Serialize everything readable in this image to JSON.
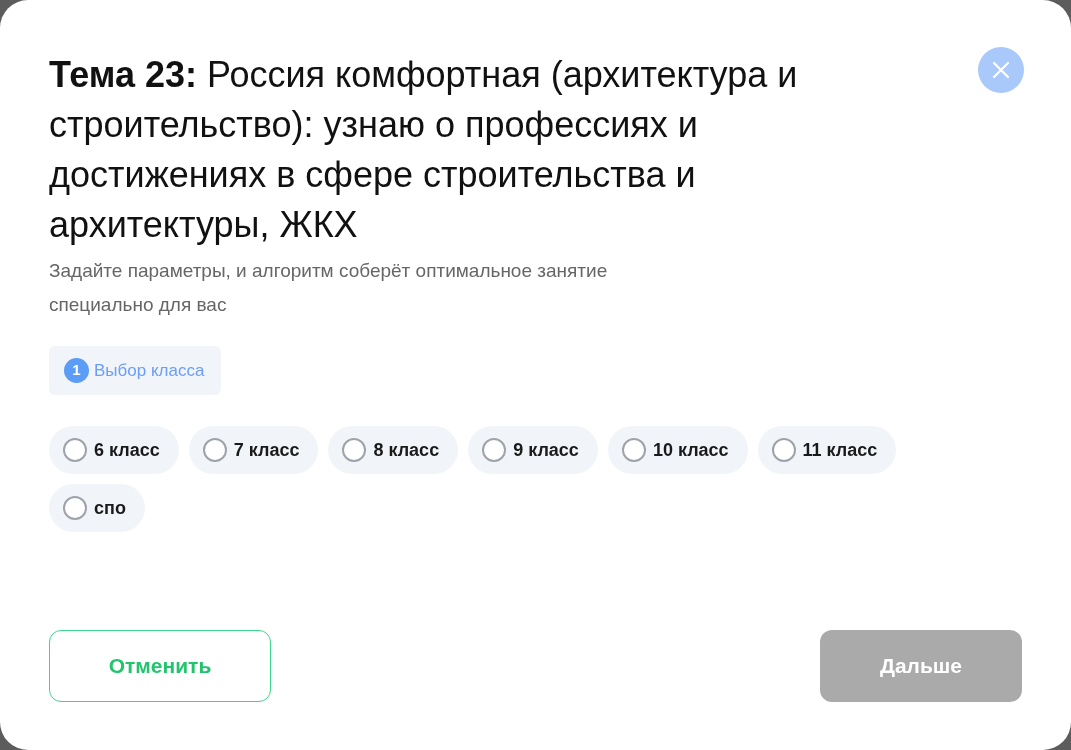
{
  "dialog": {
    "title": "**Тема 23:** Россия комфортная (архитектура и строительство): узнаю о профессиях и достижениях в сфере строительства и архитектуры, ЖКХ",
    "subtitle": "Задайте параметры, и алгоритм соберёт оптимальное занятие специально для вас",
    "steps": [
      {
        "number": "1",
        "label": "Выбор класса",
        "active": true
      }
    ],
    "options": [
      {
        "label": "6 класс",
        "selected": false
      },
      {
        "label": "7 класс",
        "selected": false
      },
      {
        "label": "8 класс",
        "selected": false
      },
      {
        "label": "9 класс",
        "selected": false
      },
      {
        "label": "10 класс",
        "selected": false
      },
      {
        "label": "11 класс",
        "selected": false
      },
      {
        "label": "спо",
        "selected": false
      }
    ],
    "buttons": [
      {
        "kind": "secondary",
        "label": "Отменить",
        "disabled": false
      },
      {
        "kind": "primary",
        "label": "Дальше",
        "disabled": true
      }
    ]
  }
}
